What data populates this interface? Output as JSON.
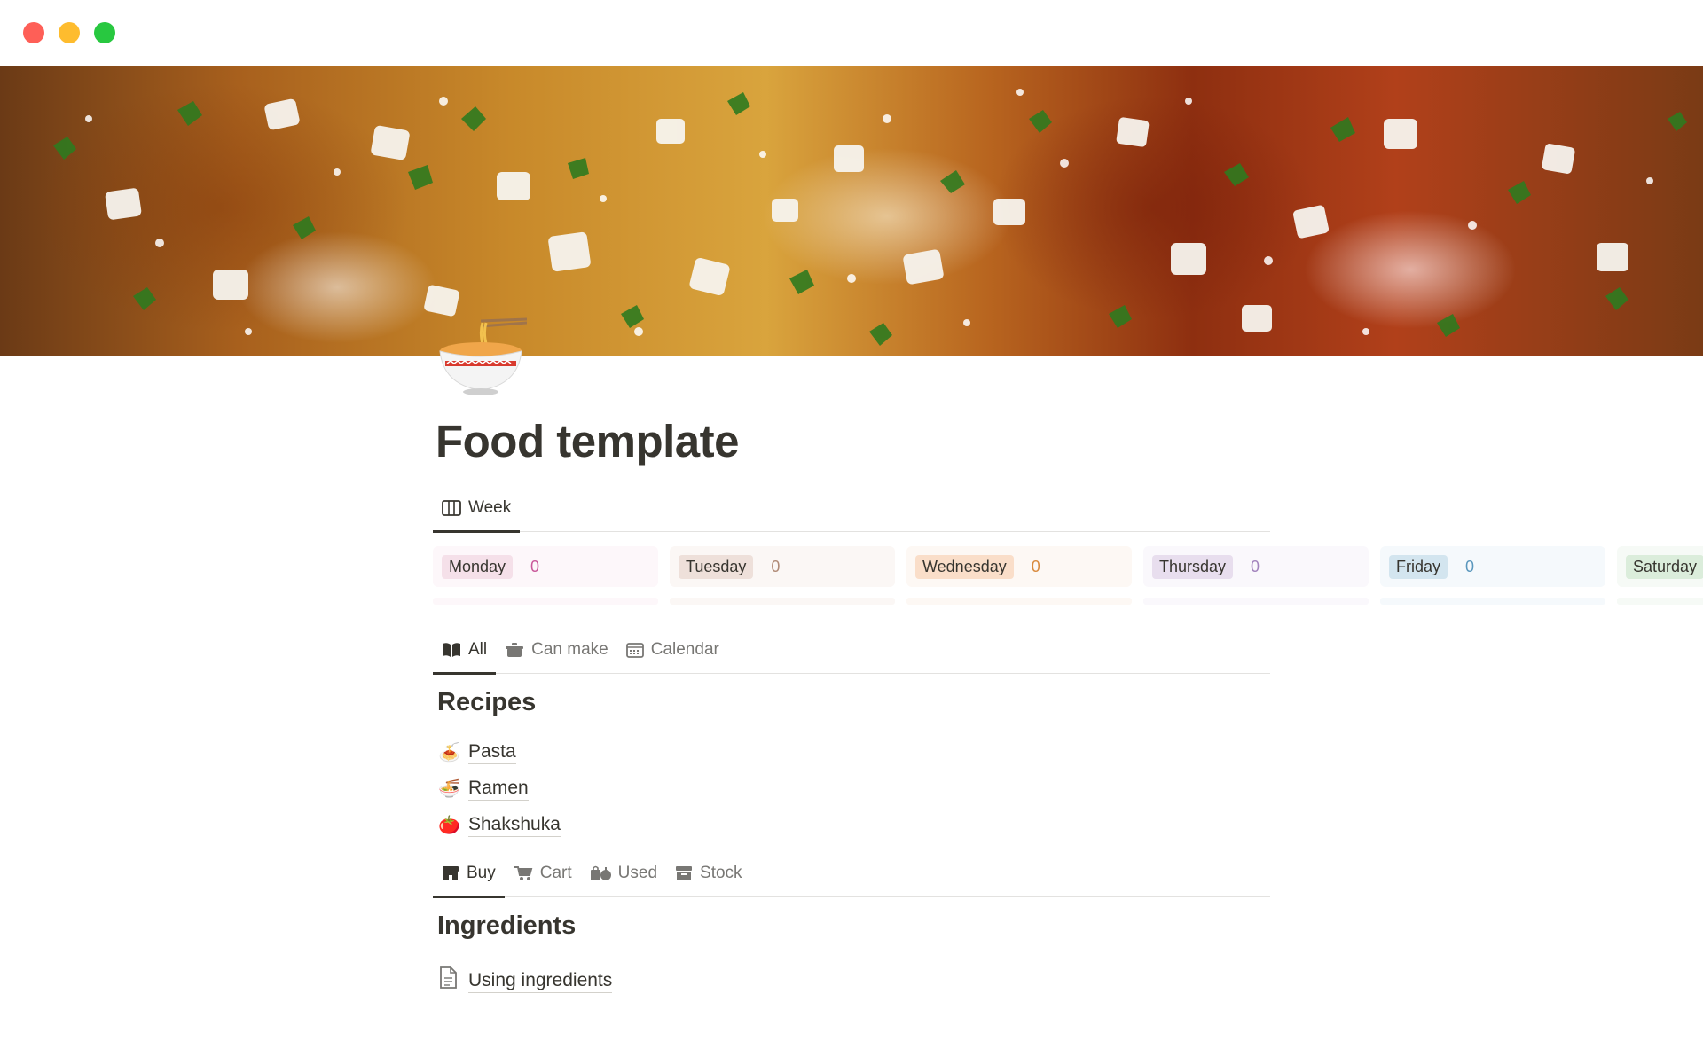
{
  "page": {
    "title": "Food template"
  },
  "week_view": {
    "tabs": [
      {
        "label": "Week",
        "icon": "board-icon",
        "active": true
      }
    ],
    "columns": [
      {
        "label": "Monday",
        "count": "0",
        "badge_bg": "#f5e0e9",
        "col_bg": "#fdf7fa",
        "count_color": "#ad1a72"
      },
      {
        "label": "Tuesday",
        "count": "0",
        "badge_bg": "#eee0da",
        "col_bg": "#fbf7f5",
        "count_color": "#9f6b53"
      },
      {
        "label": "Wednesday",
        "count": "0",
        "badge_bg": "#fadec9",
        "col_bg": "#fdf8f4",
        "count_color": "#d9730d"
      },
      {
        "label": "Thursday",
        "count": "0",
        "badge_bg": "#e8deee",
        "col_bg": "#faf8fc",
        "count_color": "#9065b0"
      },
      {
        "label": "Friday",
        "count": "0",
        "badge_bg": "#d3e5ef",
        "col_bg": "#f5f9fc",
        "count_color": "#337ea9"
      },
      {
        "label": "Saturday",
        "count": "0",
        "badge_bg": "#dbeddb",
        "col_bg": "#f6faf6",
        "count_color": "#448361"
      }
    ]
  },
  "recipes_view": {
    "tabs": [
      {
        "label": "All",
        "icon": "open-book-icon",
        "active": true
      },
      {
        "label": "Can make",
        "icon": "cooking-pot-icon",
        "active": false
      },
      {
        "label": "Calendar",
        "icon": "calendar-icon",
        "active": false
      }
    ],
    "heading": "Recipes",
    "items": [
      {
        "label": "Pasta",
        "emoji": "🍝"
      },
      {
        "label": "Ramen",
        "emoji": "🍜"
      },
      {
        "label": "Shakshuka",
        "emoji": "🍅"
      }
    ]
  },
  "ingredients_view": {
    "tabs": [
      {
        "label": "Buy",
        "icon": "store-icon",
        "active": true
      },
      {
        "label": "Cart",
        "icon": "cart-icon",
        "active": false
      },
      {
        "label": "Used",
        "icon": "bags-icon",
        "active": false
      },
      {
        "label": "Stock",
        "icon": "archive-box-icon",
        "active": false
      }
    ],
    "heading": "Ingredients",
    "link": {
      "label": "Using ingredients",
      "icon": "document-icon"
    }
  },
  "colors": {
    "text": "#37352f",
    "muted": "#787774",
    "divider": "#e3e2e0"
  }
}
